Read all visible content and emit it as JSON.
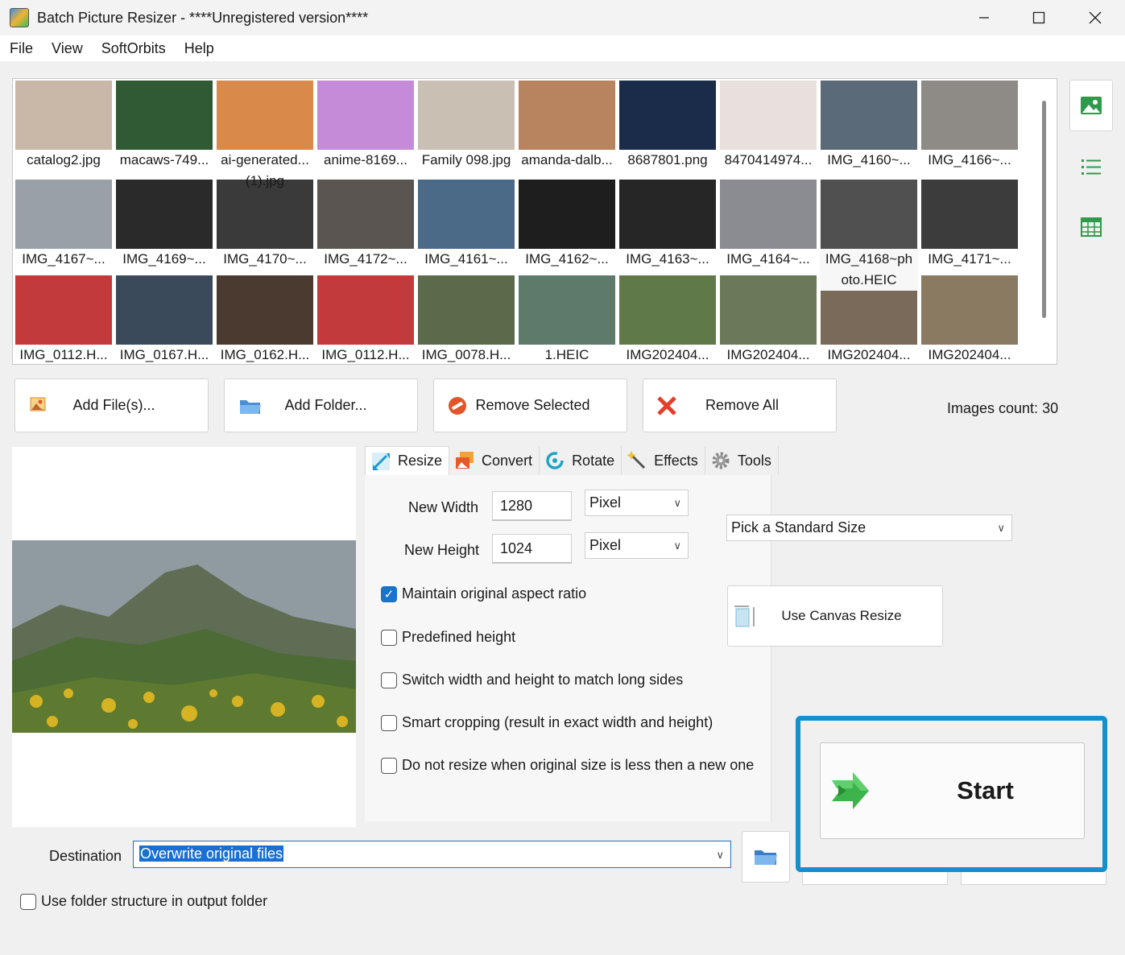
{
  "window": {
    "title": "Batch Picture Resizer - ****Unregistered version****"
  },
  "menu": [
    "File",
    "View",
    "SoftOrbits",
    "Help"
  ],
  "thumbnails": [
    {
      "label": "catalog2.jpg",
      "color": "#c9b8a8"
    },
    {
      "label": "macaws-749...",
      "color": "#2f5a33"
    },
    {
      "label": "ai-generated...",
      "label2": "(1).jpg",
      "color": "#d98a4a"
    },
    {
      "label": "anime-8169...",
      "color": "#c58bd8"
    },
    {
      "label": "Family 098.jpg",
      "color": "#c9c0b3"
    },
    {
      "label": "amanda-dalb...",
      "color": "#b8845f"
    },
    {
      "label": "8687801.png",
      "color": "#1b2c4a"
    },
    {
      "label": "8470414974...",
      "color": "#e8e0dc"
    },
    {
      "label": "IMG_4160~...",
      "color": "#5b6a78"
    },
    {
      "label": "IMG_4166~...",
      "color": "#8e8a86"
    },
    {
      "label": "IMG_4167~...",
      "color": "#9aa0a8"
    },
    {
      "label": "IMG_4169~...",
      "color": "#2a2a2a"
    },
    {
      "label": "IMG_4170~...",
      "color": "#3a3a3a"
    },
    {
      "label": "IMG_4172~...",
      "color": "#5a5550"
    },
    {
      "label": "IMG_4161~...",
      "color": "#4b6a88"
    },
    {
      "label": "IMG_4162~...",
      "color": "#1e1e1e"
    },
    {
      "label": "IMG_4163~...",
      "color": "#262626"
    },
    {
      "label": "IMG_4164~...",
      "color": "#8a8c92"
    },
    {
      "label": "IMG_4168~ph",
      "label2": "oto.HEIC",
      "color": "#505050"
    },
    {
      "label": "IMG_4171~...",
      "color": "#3c3c3c"
    },
    {
      "label": "IMG_0112.H...",
      "color": "#c23a3a"
    },
    {
      "label": "IMG_0167.H...",
      "color": "#3a4a5a"
    },
    {
      "label": "IMG_0162.H...",
      "color": "#4a3a30"
    },
    {
      "label": "IMG_0112.H...",
      "color": "#c23a3a"
    },
    {
      "label": "IMG_0078.H...",
      "color": "#5a6a4a"
    },
    {
      "label": "1.HEIC",
      "color": "#5e7a6a"
    },
    {
      "label": "IMG202404...",
      "color": "#5f7a48"
    },
    {
      "label": "IMG202404...",
      "color": "#6a7a58"
    },
    {
      "label": "IMG202404...",
      "color": "#7a6a5a"
    },
    {
      "label": "IMG202404...",
      "color": "#8a7a62"
    }
  ],
  "actions": {
    "add_files": "Add File(s)...",
    "add_folder": "Add Folder...",
    "remove_selected": "Remove Selected",
    "remove_all": "Remove All",
    "images_count": "Images count: 30"
  },
  "tabs": [
    "Resize",
    "Convert",
    "Rotate",
    "Effects",
    "Tools"
  ],
  "resize": {
    "width_label": "New Width",
    "width_value": "1280",
    "height_label": "New Height",
    "height_value": "1024",
    "width_unit": "Pixel",
    "height_unit": "Pixel",
    "standard_size": "Pick a Standard Size",
    "maintain_ratio": "Maintain original aspect ratio",
    "predefined_height": "Predefined height",
    "switch_sides": "Switch width and height to match long sides",
    "smart_crop": "Smart cropping (result in exact width and height)",
    "no_upscale": "Do not resize when original size is less then a new one",
    "canvas_resize": "Use Canvas Resize"
  },
  "start_label": "Start",
  "destination": {
    "label": "Destination",
    "value": "Overwrite original files",
    "folder_structure": "Use folder structure in output folder"
  }
}
